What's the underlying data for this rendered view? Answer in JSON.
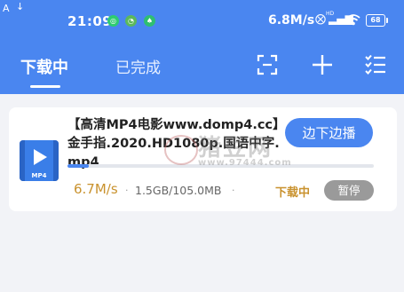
{
  "status_bar": {
    "time": "21:09",
    "network_speed": "6.8M/s",
    "hd_badge": "HD",
    "battery": "68",
    "left_icon_1": "A",
    "left_icon_2": "↓",
    "notif_icons": [
      "wechat-icon",
      "green-circle-icon",
      "green-leaf-icon"
    ]
  },
  "tabs": [
    {
      "label": "下载中",
      "active": true
    },
    {
      "label": "已完成",
      "active": false
    }
  ],
  "header_icons": [
    "scan-icon",
    "add-icon",
    "list-check-icon"
  ],
  "download": {
    "title": "【高清MP4电影www.domp4.cc】金手指.2020.HD1080p.国语中字.mp4",
    "file_type_label": "MP4",
    "action_label": "边下边播",
    "progress_fraction": 0.07,
    "speed": "6.7M/s",
    "size": "1.5GB/105.0MB",
    "separator": "·",
    "status": "下载中",
    "pause_label": "暂停"
  },
  "watermark": {
    "text": "猪豆网",
    "url": "www.97444.com"
  },
  "colors": {
    "accent": "#4a86f0",
    "speed": "#c9922e",
    "pause": "#9a9a9a"
  }
}
